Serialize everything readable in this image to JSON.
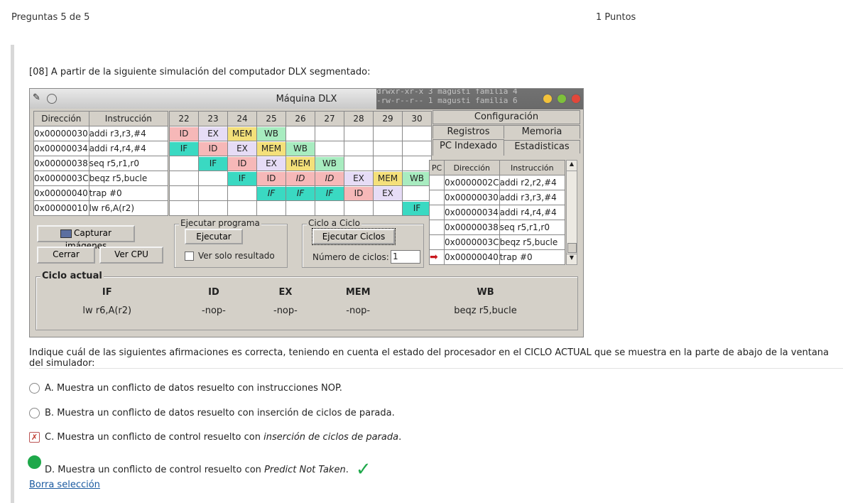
{
  "header": {
    "question_counter": "Preguntas 5 de 5",
    "points": "1 Puntos"
  },
  "question": {
    "intro": "[08] A partir de la siguiente simulación del computador DLX segmentado:",
    "prompt": "Indique cuál de las siguientes afirmaciones es correcta, teniendo en cuenta el estado del procesador en el CICLO ACTUAL que se muestra en la parte de abajo de la ventana del simulador:"
  },
  "simulator": {
    "title": "Máquina DLX",
    "terminal_text": "drwxr-xr-x 3 magusti familia 4\n-rw-r--r-- 1 magusti familia 6",
    "instr_table": {
      "headers": [
        "Dirección",
        "Instrucción"
      ],
      "rows": [
        [
          "0x00000030",
          "addi  r3,r3,#4"
        ],
        [
          "0x00000034",
          "addi  r4,r4,#4"
        ],
        [
          "0x00000038",
          "seq  r5,r1,r0"
        ],
        [
          "0x0000003C",
          "beqz  r5,bucle"
        ],
        [
          "0x00000040",
          "trap  #0"
        ],
        [
          "0x00000010",
          "lw  r6,A(r2)"
        ]
      ]
    },
    "cycles": [
      "22",
      "23",
      "24",
      "25",
      "26",
      "27",
      "28",
      "29",
      "30"
    ],
    "colors": {
      "IF": "#3ad9c2",
      "ID": "#f6b8b8",
      "EX": "#e6dcf6",
      "MEM": "#f4e07a",
      "WB": "#a8ecc0"
    },
    "pipeline": [
      [
        "ID",
        "EX",
        "MEM",
        "WB",
        "",
        "",
        "",
        "",
        ""
      ],
      [
        "IF",
        "ID",
        "EX",
        "MEM",
        "WB",
        "",
        "",
        "",
        ""
      ],
      [
        "",
        "IF",
        "ID",
        "EX",
        "MEM",
        "WB",
        "",
        "",
        ""
      ],
      [
        "",
        "",
        "IF",
        "ID",
        "ID",
        "ID",
        "EX",
        "MEM",
        "WB"
      ],
      [
        "",
        "",
        "",
        "IF",
        "IF",
        "IF",
        "ID",
        "EX",
        ""
      ],
      [
        "",
        "",
        "",
        "",
        "",
        "",
        "",
        "",
        "IF"
      ]
    ],
    "italic_cells": [
      [
        3,
        4
      ],
      [
        3,
        5
      ],
      [
        4,
        4
      ],
      [
        4,
        5
      ],
      [
        4,
        3
      ]
    ],
    "buttons": {
      "capture": "Capturar imágenes",
      "close": "Cerrar",
      "view_cpu": "Ver CPU",
      "execute": "Ejecutar",
      "execute_cycles": "Ejecutar Ciclos"
    },
    "groups": {
      "run_program": "Ejecutar programa",
      "only_result": "Ver solo resultado",
      "cycle_by_cycle": "Ciclo a Ciclo",
      "num_cycles_label": "Número de ciclos:",
      "num_cycles_value": "1"
    },
    "tabs": {
      "config": "Configuración",
      "registers": "Registros",
      "memory": "Memoria",
      "pc_indexed": "PC Indexado",
      "stats": "Estadisticas"
    },
    "pc_table": {
      "headers": [
        "PC",
        "Dirección",
        "Instrucción"
      ],
      "rows": [
        [
          "",
          "0x0000002C",
          "addi  r2,r2,#4"
        ],
        [
          "",
          "0x00000030",
          "addi  r3,r3,#4"
        ],
        [
          "",
          "0x00000034",
          "addi  r4,r4,#4"
        ],
        [
          "",
          "0x00000038",
          "seq  r5,r1,r0"
        ],
        [
          "",
          "0x0000003C",
          "beqz  r5,bucle"
        ],
        [
          "arrow",
          "0x00000040",
          "trap  #0"
        ]
      ]
    },
    "current_cycle": {
      "label": "Ciclo actual",
      "stages": [
        "IF",
        "ID",
        "EX",
        "MEM",
        "WB"
      ],
      "values": [
        "lw  r6,A(r2)",
        "-nop-",
        "-nop-",
        "-nop-",
        "beqz  r5,bucle"
      ]
    }
  },
  "options": [
    {
      "letter": "A.",
      "text": "Muestra un conflicto de datos resuelto con instrucciones NOP.",
      "emph": "",
      "state": "empty"
    },
    {
      "letter": "B.",
      "text": "Muestra un conflicto de datos resuelto con inserción de ciclos de parada.",
      "emph": "",
      "state": "empty"
    },
    {
      "letter": "C.",
      "text": "Muestra un conflicto de control resuelto con ",
      "emph": "inserción de ciclos de parada",
      "state": "wrong"
    },
    {
      "letter": "D.",
      "text": "Muestra un conflicto de control resuelto con ",
      "emph": "Predict Not Taken",
      "state": "correct"
    }
  ],
  "clear_link": "Borra selección"
}
